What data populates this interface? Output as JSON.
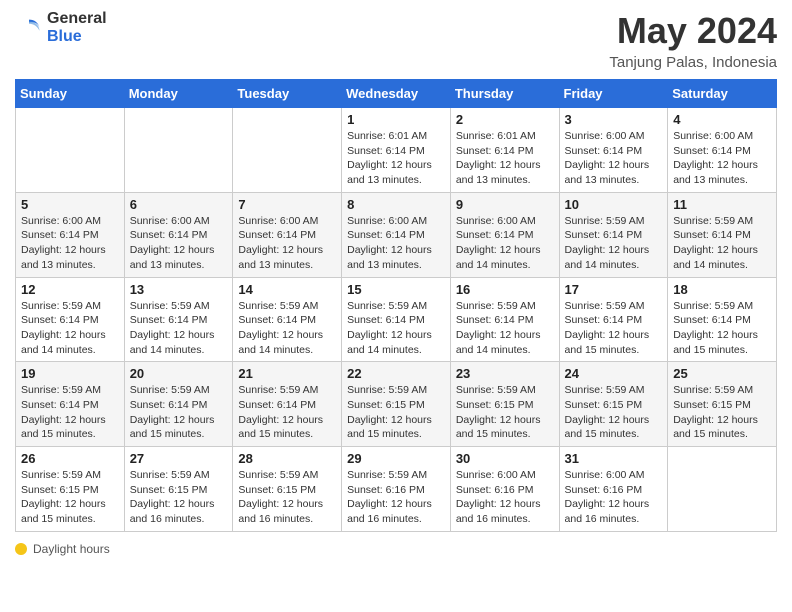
{
  "header": {
    "logo_general": "General",
    "logo_blue": "Blue",
    "month_title": "May 2024",
    "location": "Tanjung Palas, Indonesia"
  },
  "calendar": {
    "days_of_week": [
      "Sunday",
      "Monday",
      "Tuesday",
      "Wednesday",
      "Thursday",
      "Friday",
      "Saturday"
    ],
    "weeks": [
      [
        {
          "day": "",
          "info": ""
        },
        {
          "day": "",
          "info": ""
        },
        {
          "day": "",
          "info": ""
        },
        {
          "day": "1",
          "info": "Sunrise: 6:01 AM\nSunset: 6:14 PM\nDaylight: 12 hours\nand 13 minutes."
        },
        {
          "day": "2",
          "info": "Sunrise: 6:01 AM\nSunset: 6:14 PM\nDaylight: 12 hours\nand 13 minutes."
        },
        {
          "day": "3",
          "info": "Sunrise: 6:00 AM\nSunset: 6:14 PM\nDaylight: 12 hours\nand 13 minutes."
        },
        {
          "day": "4",
          "info": "Sunrise: 6:00 AM\nSunset: 6:14 PM\nDaylight: 12 hours\nand 13 minutes."
        }
      ],
      [
        {
          "day": "5",
          "info": "Sunrise: 6:00 AM\nSunset: 6:14 PM\nDaylight: 12 hours\nand 13 minutes."
        },
        {
          "day": "6",
          "info": "Sunrise: 6:00 AM\nSunset: 6:14 PM\nDaylight: 12 hours\nand 13 minutes."
        },
        {
          "day": "7",
          "info": "Sunrise: 6:00 AM\nSunset: 6:14 PM\nDaylight: 12 hours\nand 13 minutes."
        },
        {
          "day": "8",
          "info": "Sunrise: 6:00 AM\nSunset: 6:14 PM\nDaylight: 12 hours\nand 13 minutes."
        },
        {
          "day": "9",
          "info": "Sunrise: 6:00 AM\nSunset: 6:14 PM\nDaylight: 12 hours\nand 14 minutes."
        },
        {
          "day": "10",
          "info": "Sunrise: 5:59 AM\nSunset: 6:14 PM\nDaylight: 12 hours\nand 14 minutes."
        },
        {
          "day": "11",
          "info": "Sunrise: 5:59 AM\nSunset: 6:14 PM\nDaylight: 12 hours\nand 14 minutes."
        }
      ],
      [
        {
          "day": "12",
          "info": "Sunrise: 5:59 AM\nSunset: 6:14 PM\nDaylight: 12 hours\nand 14 minutes."
        },
        {
          "day": "13",
          "info": "Sunrise: 5:59 AM\nSunset: 6:14 PM\nDaylight: 12 hours\nand 14 minutes."
        },
        {
          "day": "14",
          "info": "Sunrise: 5:59 AM\nSunset: 6:14 PM\nDaylight: 12 hours\nand 14 minutes."
        },
        {
          "day": "15",
          "info": "Sunrise: 5:59 AM\nSunset: 6:14 PM\nDaylight: 12 hours\nand 14 minutes."
        },
        {
          "day": "16",
          "info": "Sunrise: 5:59 AM\nSunset: 6:14 PM\nDaylight: 12 hours\nand 14 minutes."
        },
        {
          "day": "17",
          "info": "Sunrise: 5:59 AM\nSunset: 6:14 PM\nDaylight: 12 hours\nand 15 minutes."
        },
        {
          "day": "18",
          "info": "Sunrise: 5:59 AM\nSunset: 6:14 PM\nDaylight: 12 hours\nand 15 minutes."
        }
      ],
      [
        {
          "day": "19",
          "info": "Sunrise: 5:59 AM\nSunset: 6:14 PM\nDaylight: 12 hours\nand 15 minutes."
        },
        {
          "day": "20",
          "info": "Sunrise: 5:59 AM\nSunset: 6:14 PM\nDaylight: 12 hours\nand 15 minutes."
        },
        {
          "day": "21",
          "info": "Sunrise: 5:59 AM\nSunset: 6:14 PM\nDaylight: 12 hours\nand 15 minutes."
        },
        {
          "day": "22",
          "info": "Sunrise: 5:59 AM\nSunset: 6:15 PM\nDaylight: 12 hours\nand 15 minutes."
        },
        {
          "day": "23",
          "info": "Sunrise: 5:59 AM\nSunset: 6:15 PM\nDaylight: 12 hours\nand 15 minutes."
        },
        {
          "day": "24",
          "info": "Sunrise: 5:59 AM\nSunset: 6:15 PM\nDaylight: 12 hours\nand 15 minutes."
        },
        {
          "day": "25",
          "info": "Sunrise: 5:59 AM\nSunset: 6:15 PM\nDaylight: 12 hours\nand 15 minutes."
        }
      ],
      [
        {
          "day": "26",
          "info": "Sunrise: 5:59 AM\nSunset: 6:15 PM\nDaylight: 12 hours\nand 15 minutes."
        },
        {
          "day": "27",
          "info": "Sunrise: 5:59 AM\nSunset: 6:15 PM\nDaylight: 12 hours\nand 16 minutes."
        },
        {
          "day": "28",
          "info": "Sunrise: 5:59 AM\nSunset: 6:15 PM\nDaylight: 12 hours\nand 16 minutes."
        },
        {
          "day": "29",
          "info": "Sunrise: 5:59 AM\nSunset: 6:16 PM\nDaylight: 12 hours\nand 16 minutes."
        },
        {
          "day": "30",
          "info": "Sunrise: 6:00 AM\nSunset: 6:16 PM\nDaylight: 12 hours\nand 16 minutes."
        },
        {
          "day": "31",
          "info": "Sunrise: 6:00 AM\nSunset: 6:16 PM\nDaylight: 12 hours\nand 16 minutes."
        },
        {
          "day": "",
          "info": ""
        }
      ]
    ]
  },
  "footer": {
    "daylight_label": "Daylight hours"
  }
}
